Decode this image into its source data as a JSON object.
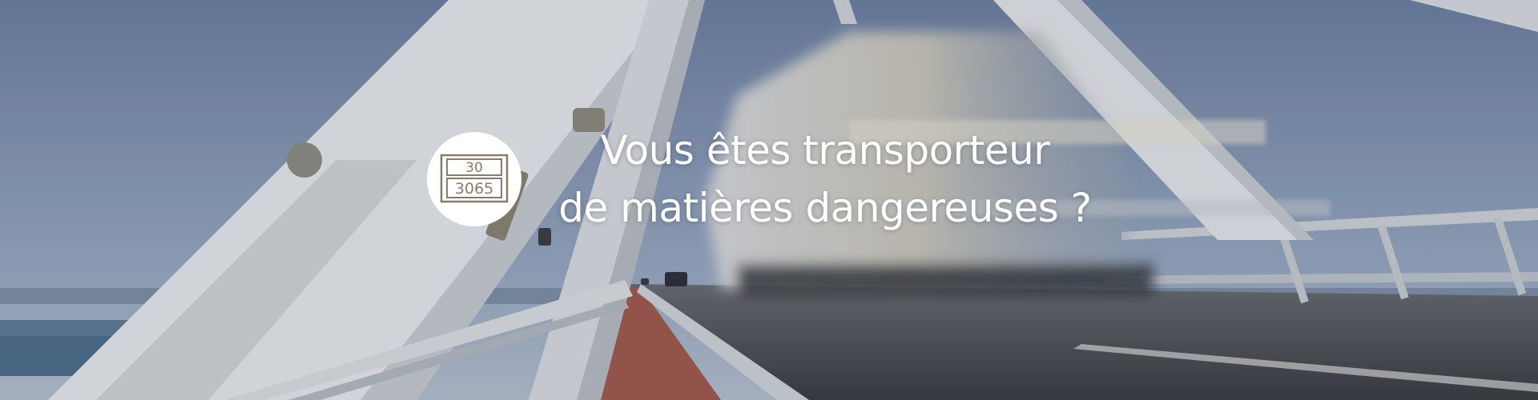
{
  "hero": {
    "headline_line1": "Vous êtes transporteur",
    "headline_line2": "de matières dangereuses  ?",
    "badge": {
      "icon": "hazmat-orange-plate-icon",
      "hazard_number": "30",
      "un_number": "3065"
    }
  },
  "colors": {
    "sky_top": "#6f82a3",
    "sky_bottom": "#a7b6cc",
    "bridge_white": "#e4e6ea",
    "road": "#4d4f55",
    "walkway": "#9a5a4e",
    "text": "#ffffff",
    "badge_plate": "#8a7a67"
  }
}
